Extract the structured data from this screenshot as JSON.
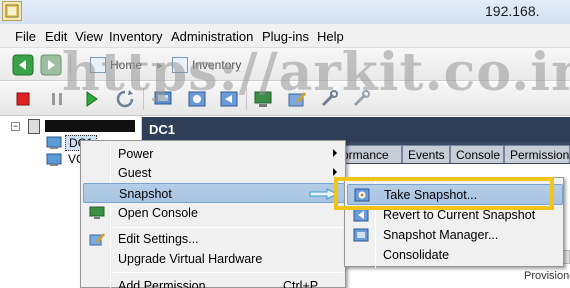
{
  "window": {
    "title": "192.168."
  },
  "menubar": {
    "items": [
      "File",
      "Edit",
      "View",
      "Inventory",
      "Administration",
      "Plug-ins",
      "Help"
    ]
  },
  "breadcrumb": {
    "first": "Home",
    "second": "Inventory"
  },
  "tree": {
    "dc_label": "DC1",
    "vm_label": "VC"
  },
  "pane": {
    "title": "DC1",
    "tabs": [
      "ormance",
      "Events",
      "Console",
      "Permissions"
    ],
    "right_text": "Provisione"
  },
  "context_menu": {
    "items": [
      {
        "label": "Power",
        "submenu": true
      },
      {
        "label": "Guest",
        "submenu": true
      },
      {
        "label": "Snapshot",
        "submenu": true
      },
      {
        "label": "Open Console",
        "submenu": false
      },
      {
        "label": "Edit Settings...",
        "submenu": false
      },
      {
        "label": "Upgrade Virtual Hardware",
        "submenu": false
      },
      {
        "label": "Add Permission...",
        "shortcut": "Ctrl+P"
      }
    ]
  },
  "snapshot_submenu": {
    "items": [
      "Take Snapshot...",
      "Revert to Current Snapshot",
      "Snapshot Manager...",
      "Consolidate"
    ]
  },
  "watermark": {
    "text": "https://arkit.co.in"
  },
  "colors": {
    "pane_header": "#2f3e57",
    "highlight": "#f0c419",
    "selection": "#b5cde6"
  }
}
